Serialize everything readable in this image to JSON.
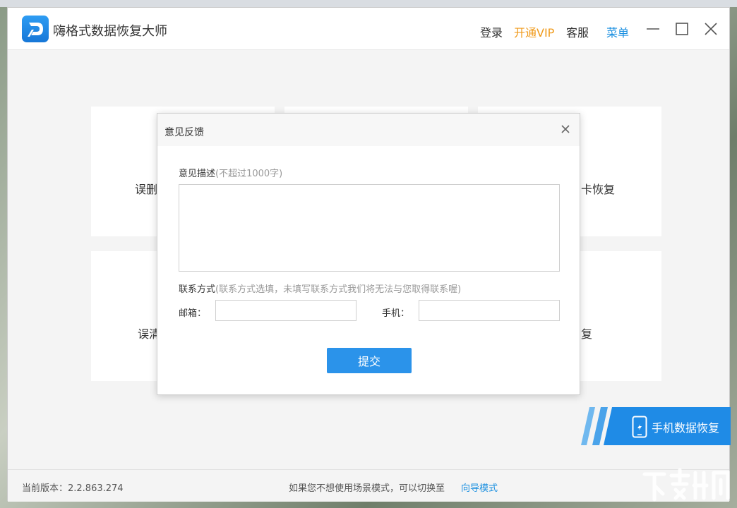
{
  "app": {
    "title": "嗨格式数据恢复大师",
    "links": {
      "login": "登录",
      "vip": "开通VIP",
      "service": "客服",
      "menu": "菜单"
    }
  },
  "cards": {
    "card1_label": "误删",
    "card3_label": "卡恢复",
    "card4_label": "误清",
    "card6_label": "复"
  },
  "mobile_banner": {
    "label": "手机数据恢复"
  },
  "footer": {
    "version": "当前版本：2.2.863.274",
    "tip": "如果您不想使用场景模式，可以切换至",
    "link": "向导模式"
  },
  "modal": {
    "title": "意见反馈",
    "desc_label": "意见描述",
    "desc_hint": "(不超过1000字)",
    "contact_label": "联系方式",
    "contact_hint": "(联系方式选填，未填写联系方式我们将无法与您取得联系喔)",
    "email_label": "邮箱：",
    "email_value": "",
    "phone_label": "手机：",
    "phone_value": "",
    "submit": "提交"
  },
  "colors": {
    "accent": "#2b93ea",
    "vip": "#f09a1a",
    "link": "#1a8fe0"
  }
}
